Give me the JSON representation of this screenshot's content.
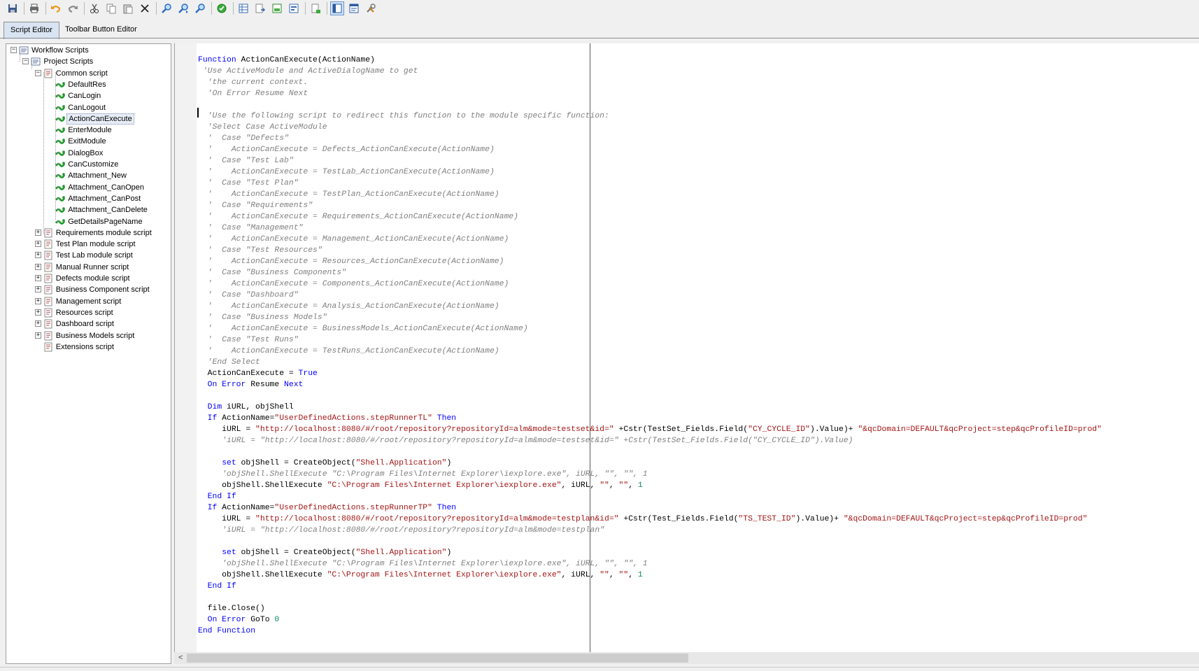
{
  "toolbar": {
    "buttons": [
      "save-icon",
      "print-icon",
      "undo-icon",
      "redo-icon",
      "cut-icon",
      "copy-icon",
      "paste-icon",
      "delete-icon",
      "find-icon",
      "find-next-icon",
      "replace-icon",
      "syntax-check-icon",
      "table-icon",
      "import-icon",
      "export-icon",
      "page-icon",
      "script-generator-icon",
      "script-view-icon",
      "properties-view-icon",
      "tools-icon"
    ]
  },
  "tabs": {
    "script_editor": "Script Editor",
    "toolbar_button_editor": "Toolbar Button Editor"
  },
  "tree": {
    "root": "Workflow Scripts",
    "project": "Project Scripts",
    "common": "Common script",
    "common_children": [
      "DefaultRes",
      "CanLogin",
      "CanLogout",
      "ActionCanExecute",
      "EnterModule",
      "ExitModule",
      "DialogBox",
      "CanCustomize",
      "Attachment_New",
      "Attachment_CanOpen",
      "Attachment_CanPost",
      "Attachment_CanDelete",
      "GetDetailsPageName"
    ],
    "selected": "ActionCanExecute",
    "modules": [
      "Requirements module script",
      "Test Plan module script",
      "Test Lab module script",
      "Manual Runner script",
      "Defects module script",
      "Business Component script",
      "Management script",
      "Resources script",
      "Dashboard script",
      "Business Models script",
      "Extensions script"
    ]
  },
  "code": {
    "lines": [
      [
        [
          "kw",
          "Function"
        ],
        [
          "n",
          " ActionCanExecute(ActionName)"
        ]
      ],
      [
        [
          "n",
          " "
        ],
        [
          "cm",
          "'Use ActiveModule and ActiveDialogName to get"
        ]
      ],
      [
        [
          "n",
          "  "
        ],
        [
          "cm",
          "'the current context."
        ]
      ],
      [
        [
          "n",
          "  "
        ],
        [
          "cm",
          "'On Error Resume Next"
        ]
      ],
      [],
      [
        [
          "n",
          "  "
        ],
        [
          "cm",
          "'Use the following script to redirect this function to the module specific function:"
        ]
      ],
      [
        [
          "n",
          "  "
        ],
        [
          "cm",
          "'Select Case ActiveModule"
        ]
      ],
      [
        [
          "n",
          "  "
        ],
        [
          "cm",
          "'  Case \"Defects\""
        ]
      ],
      [
        [
          "n",
          "  "
        ],
        [
          "cm",
          "'    ActionCanExecute = Defects_ActionCanExecute(ActionName)"
        ]
      ],
      [
        [
          "n",
          "  "
        ],
        [
          "cm",
          "'  Case \"Test Lab\""
        ]
      ],
      [
        [
          "n",
          "  "
        ],
        [
          "cm",
          "'    ActionCanExecute = TestLab_ActionCanExecute(ActionName)"
        ]
      ],
      [
        [
          "n",
          "  "
        ],
        [
          "cm",
          "'  Case \"Test Plan\""
        ]
      ],
      [
        [
          "n",
          "  "
        ],
        [
          "cm",
          "'    ActionCanExecute = TestPlan_ActionCanExecute(ActionName)"
        ]
      ],
      [
        [
          "n",
          "  "
        ],
        [
          "cm",
          "'  Case \"Requirements\""
        ]
      ],
      [
        [
          "n",
          "  "
        ],
        [
          "cm",
          "'    ActionCanExecute = Requirements_ActionCanExecute(ActionName)"
        ]
      ],
      [
        [
          "n",
          "  "
        ],
        [
          "cm",
          "'  Case \"Management\""
        ]
      ],
      [
        [
          "n",
          "  "
        ],
        [
          "cm",
          "'    ActionCanExecute = Management_ActionCanExecute(ActionName)"
        ]
      ],
      [
        [
          "n",
          "  "
        ],
        [
          "cm",
          "'  Case \"Test Resources\""
        ]
      ],
      [
        [
          "n",
          "  "
        ],
        [
          "cm",
          "'    ActionCanExecute = Resources_ActionCanExecute(ActionName)"
        ]
      ],
      [
        [
          "n",
          "  "
        ],
        [
          "cm",
          "'  Case \"Business Components\""
        ]
      ],
      [
        [
          "n",
          "  "
        ],
        [
          "cm",
          "'    ActionCanExecute = Components_ActionCanExecute(ActionName)"
        ]
      ],
      [
        [
          "n",
          "  "
        ],
        [
          "cm",
          "'  Case \"Dashboard\""
        ]
      ],
      [
        [
          "n",
          "  "
        ],
        [
          "cm",
          "'    ActionCanExecute = Analysis_ActionCanExecute(ActionName)"
        ]
      ],
      [
        [
          "n",
          "  "
        ],
        [
          "cm",
          "'  Case \"Business Models\""
        ]
      ],
      [
        [
          "n",
          "  "
        ],
        [
          "cm",
          "'    ActionCanExecute = BusinessModels_ActionCanExecute(ActionName)"
        ]
      ],
      [
        [
          "n",
          "  "
        ],
        [
          "cm",
          "'  Case \"Test Runs\""
        ]
      ],
      [
        [
          "n",
          "  "
        ],
        [
          "cm",
          "'    ActionCanExecute = TestRuns_ActionCanExecute(ActionName)"
        ]
      ],
      [
        [
          "n",
          "  "
        ],
        [
          "cm",
          "'End Select"
        ]
      ],
      [
        [
          "n",
          "  ActionCanExecute = "
        ],
        [
          "kw",
          "True"
        ]
      ],
      [
        [
          "n",
          "  "
        ],
        [
          "kw",
          "On Error"
        ],
        [
          "n",
          " Resume "
        ],
        [
          "kw",
          "Next"
        ]
      ],
      [],
      [
        [
          "n",
          "  "
        ],
        [
          "kw",
          "Dim"
        ],
        [
          "n",
          " iURL, objShell"
        ]
      ],
      [
        [
          "n",
          "  "
        ],
        [
          "kw",
          "If"
        ],
        [
          "n",
          " ActionName="
        ],
        [
          "st",
          "\"UserDefinedActions.stepRunnerTL\""
        ],
        [
          "n",
          " "
        ],
        [
          "kw",
          "Then"
        ]
      ],
      [
        [
          "n",
          "     iURL = "
        ],
        [
          "st",
          "\"http://localhost:8080/#/root/repository?repositoryId=alm&mode=testset&id=\""
        ],
        [
          "n",
          " +Cstr(TestSet_Fields.Field("
        ],
        [
          "st",
          "\"CY_CYCLE_ID\""
        ],
        [
          "n",
          ").Value)+ "
        ],
        [
          "st",
          "\"&qcDomain=DEFAULT&qcProject=step&qcProfileID=prod\""
        ]
      ],
      [
        [
          "n",
          "     "
        ],
        [
          "cm",
          "'iURL = \"http://localhost:8080/#/root/repository?repositoryId=alm&mode=testset&id=\" +Cstr(TestSet_Fields.Field(\"CY_CYCLE_ID\").Value)"
        ]
      ],
      [],
      [
        [
          "n",
          "     "
        ],
        [
          "kw",
          "set"
        ],
        [
          "n",
          " objShell = CreateObject("
        ],
        [
          "st",
          "\"Shell.Application\""
        ],
        [
          "n",
          ")"
        ]
      ],
      [
        [
          "n",
          "     "
        ],
        [
          "cm",
          "'objShell.ShellExecute \"C:\\Program Files\\Internet Explorer\\iexplore.exe\", iURL, \"\", \"\", 1"
        ]
      ],
      [
        [
          "n",
          "     objShell.ShellExecute "
        ],
        [
          "st",
          "\"C:\\Program Files\\Internet Explorer\\iexplore.exe\""
        ],
        [
          "n",
          ", iURL, "
        ],
        [
          "st",
          "\"\""
        ],
        [
          "n",
          ", "
        ],
        [
          "st",
          "\"\""
        ],
        [
          "n",
          ", "
        ],
        [
          "nu",
          "1"
        ]
      ],
      [
        [
          "n",
          "  "
        ],
        [
          "kw",
          "End If"
        ]
      ],
      [
        [
          "n",
          "  "
        ],
        [
          "kw",
          "If"
        ],
        [
          "n",
          " ActionName="
        ],
        [
          "st",
          "\"UserDefinedActions.stepRunnerTP\""
        ],
        [
          "n",
          " "
        ],
        [
          "kw",
          "Then"
        ]
      ],
      [
        [
          "n",
          "     iURL = "
        ],
        [
          "st",
          "\"http://localhost:8080/#/root/repository?repositoryId=alm&mode=testplan&id=\""
        ],
        [
          "n",
          " +Cstr(Test_Fields.Field("
        ],
        [
          "st",
          "\"TS_TEST_ID\""
        ],
        [
          "n",
          ").Value)+ "
        ],
        [
          "st",
          "\"&qcDomain=DEFAULT&qcProject=step&qcProfileID=prod\""
        ]
      ],
      [
        [
          "n",
          "     "
        ],
        [
          "cm",
          "'iURL = \"http://localhost:8080/#/root/repository?repositoryId=alm&mode=testplan\""
        ]
      ],
      [],
      [
        [
          "n",
          "     "
        ],
        [
          "kw",
          "set"
        ],
        [
          "n",
          " objShell = CreateObject("
        ],
        [
          "st",
          "\"Shell.Application\""
        ],
        [
          "n",
          ")"
        ]
      ],
      [
        [
          "n",
          "     "
        ],
        [
          "cm",
          "'objShell.ShellExecute \"C:\\Program Files\\Internet Explorer\\iexplore.exe\", iURL, \"\", \"\", 1"
        ]
      ],
      [
        [
          "n",
          "     objShell.ShellExecute "
        ],
        [
          "st",
          "\"C:\\Program Files\\Internet Explorer\\iexplore.exe\""
        ],
        [
          "n",
          ", iURL, "
        ],
        [
          "st",
          "\"\""
        ],
        [
          "n",
          ", "
        ],
        [
          "st",
          "\"\""
        ],
        [
          "n",
          ", "
        ],
        [
          "nu",
          "1"
        ]
      ],
      [
        [
          "n",
          "  "
        ],
        [
          "kw",
          "End If"
        ]
      ],
      [],
      [
        [
          "n",
          "  file.Close()"
        ]
      ],
      [
        [
          "n",
          "  "
        ],
        [
          "kw",
          "On Error"
        ],
        [
          "n",
          " GoTo "
        ],
        [
          "nu",
          "0"
        ]
      ],
      [
        [
          "kw",
          "End Function"
        ]
      ]
    ]
  },
  "scrollbar": {
    "left_arrow": "<"
  }
}
